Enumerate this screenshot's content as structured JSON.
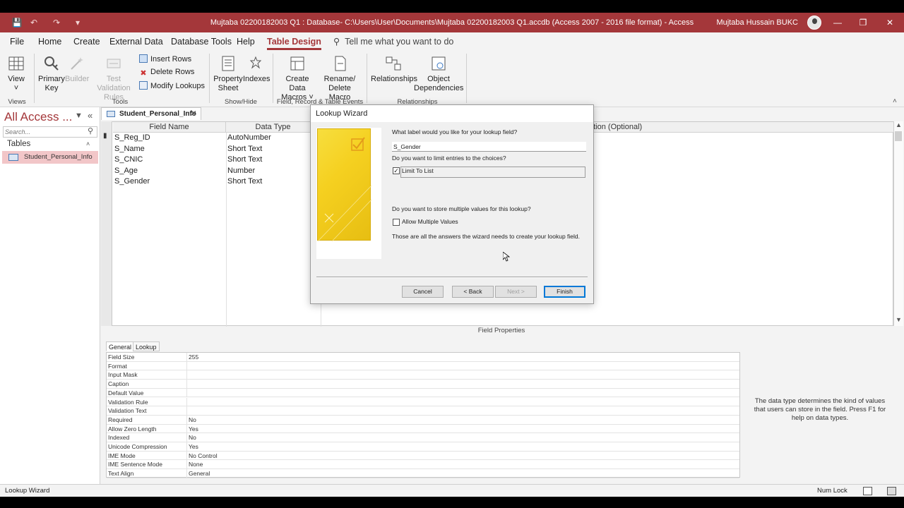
{
  "window": {
    "title": "Mujtaba 02200182003 Q1 : Database- C:\\Users\\User\\Documents\\Mujtaba 02200182003 Q1.accdb (Access 2007 - 2016 file format)  -  Access",
    "user": "Mujtaba Hussain BUKC"
  },
  "menu": {
    "items": [
      "File",
      "Home",
      "Create",
      "External Data",
      "Database Tools",
      "Help",
      "Table Design"
    ],
    "tell_me": "Tell me what you want to do"
  },
  "ribbon": {
    "view": "View",
    "primary_key_1": "Primary",
    "primary_key_2": "Key",
    "builder": "Builder",
    "test_validation_1": "Test Validation",
    "test_validation_2": "Rules",
    "insert_rows": "Insert Rows",
    "delete_rows": "Delete Rows",
    "modify_lookups": "Modify Lookups",
    "property_sheet_1": "Property",
    "property_sheet_2": "Sheet",
    "indexes": "Indexes",
    "create_data_macros_1": "Create Data",
    "create_data_macros_2": "Macros",
    "rename_delete_macro_1": "Rename/",
    "rename_delete_macro_2": "Delete Macro",
    "relationships": "Relationships",
    "object_dependencies_1": "Object",
    "object_dependencies_2": "Dependencies",
    "groups": [
      "Views",
      "Tools",
      "Show/Hide",
      "Field, Record & Table Events",
      "Relationships"
    ]
  },
  "nav": {
    "header": "All Access ...",
    "search_placeholder": "Search...",
    "section": "Tables",
    "items": [
      "Student_Personal_Info"
    ]
  },
  "table": {
    "tab": "Student_Personal_Info",
    "headers": [
      "Field Name",
      "Data Type",
      "ption (Optional)"
    ],
    "rows": [
      {
        "name": "S_Reg_ID",
        "type": "AutoNumber"
      },
      {
        "name": "S_Name",
        "type": "Short Text"
      },
      {
        "name": "S_CNIC",
        "type": "Short Text"
      },
      {
        "name": "S_Age",
        "type": "Number"
      },
      {
        "name": "S_Gender",
        "type": "Short Text"
      }
    ]
  },
  "field_properties": {
    "title": "Field Properties",
    "tabs": [
      "General",
      "Lookup"
    ],
    "rows": [
      {
        "k": "Field Size",
        "v": "255"
      },
      {
        "k": "Format",
        "v": ""
      },
      {
        "k": "Input Mask",
        "v": ""
      },
      {
        "k": "Caption",
        "v": ""
      },
      {
        "k": "Default Value",
        "v": ""
      },
      {
        "k": "Validation Rule",
        "v": ""
      },
      {
        "k": "Validation Text",
        "v": ""
      },
      {
        "k": "Required",
        "v": "No"
      },
      {
        "k": "Allow Zero Length",
        "v": "Yes"
      },
      {
        "k": "Indexed",
        "v": "No"
      },
      {
        "k": "Unicode Compression",
        "v": "Yes"
      },
      {
        "k": "IME Mode",
        "v": "No Control"
      },
      {
        "k": "IME Sentence Mode",
        "v": "None"
      },
      {
        "k": "Text Align",
        "v": "General"
      }
    ],
    "help": "The data type determines the kind of values that users can store in the field. Press F1 for help on data types."
  },
  "dialog": {
    "title": "Lookup Wizard",
    "q_label": "What label would you like for your lookup field?",
    "label_value": "S_Gender",
    "q_limit": "Do you want to limit entries to the choices?",
    "limit_label": "Limit To List",
    "limit_checked": true,
    "q_multi": "Do you want to store multiple values for this lookup?",
    "multi_label": "Allow Multiple Values",
    "multi_checked": false,
    "info": "Those are all the answers the wizard needs to create your lookup field.",
    "cancel": "Cancel",
    "back": "< Back",
    "next": "Next >",
    "finish": "Finish"
  },
  "status": {
    "left": "Lookup Wizard",
    "num_lock": "Num Lock"
  }
}
